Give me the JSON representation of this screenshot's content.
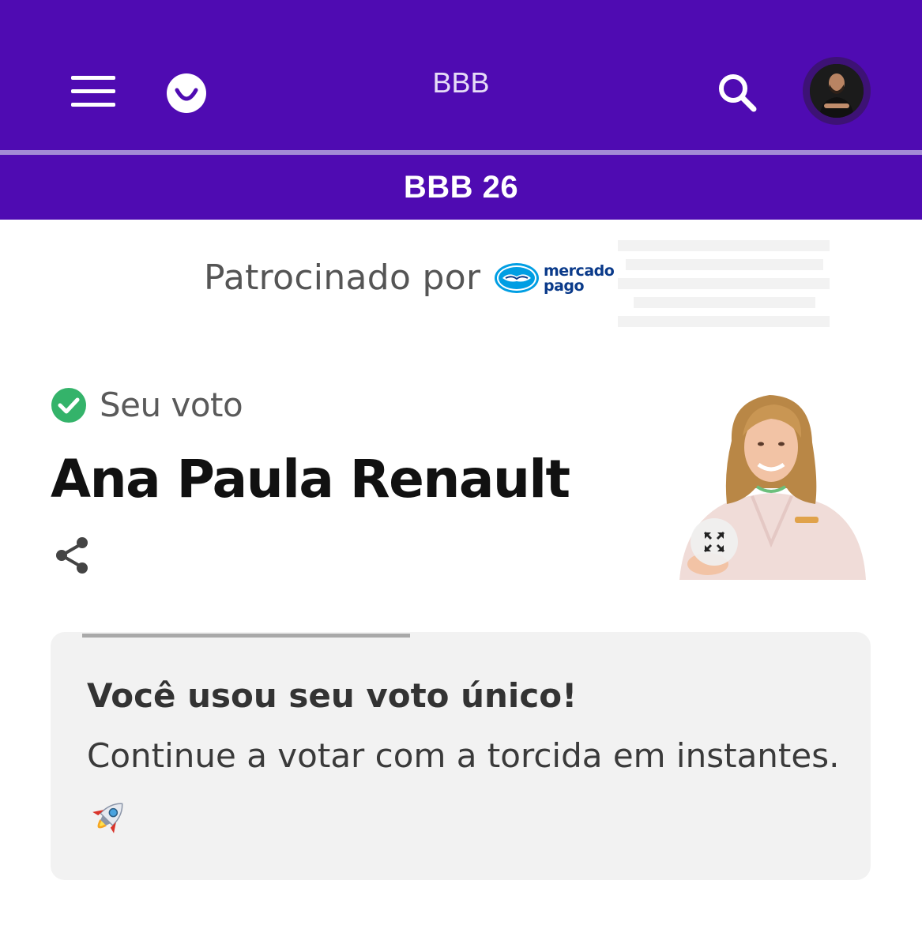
{
  "header": {
    "title": "BBB",
    "menu_icon": "hamburger-menu-icon",
    "logo_icon": "smile-logo-icon",
    "search_icon": "search-icon",
    "avatar_icon": "user-avatar-icon",
    "bg_color": "#4f0bb2"
  },
  "subheader": {
    "title": "BBB 26"
  },
  "sponsor": {
    "label": "Patrocinado por",
    "brand_line1": "mercado",
    "brand_line2": "pago",
    "brand_color": "#0a3a8a"
  },
  "vote": {
    "status_label": "Seu voto",
    "status_icon": "check-circle-icon",
    "status_color": "#34b36a",
    "candidate_name": "Ana Paula Renault",
    "share_icon": "share-icon",
    "expand_icon": "expand-icon"
  },
  "card": {
    "progress": 0.4,
    "title": "Você usou seu voto único!",
    "message": "Continue a votar com a torcida em instantes.",
    "emoji_icon": "rocket-icon"
  }
}
